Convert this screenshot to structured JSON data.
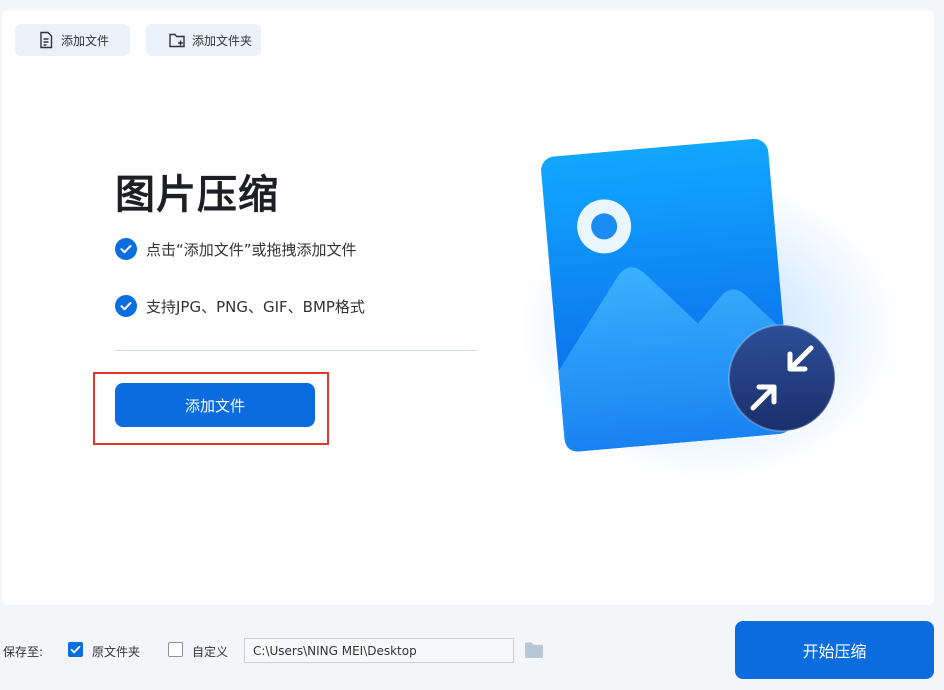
{
  "toolbar": {
    "add_file_label": "添加文件",
    "add_folder_label": "添加文件夹"
  },
  "main": {
    "title": "图片压缩",
    "features": [
      "点击“添加文件”或拖拽添加文件",
      "支持JPG、PNG、GIF、BMP格式"
    ],
    "add_file_button": "添加文件"
  },
  "bottom": {
    "save_to_label": "保存至:",
    "option_original": "原文件夹",
    "option_original_checked": true,
    "option_custom": "自定义",
    "option_custom_checked": false,
    "path_value": "C:\\Users\\NING MEI\\Desktop",
    "start_button": "开始压缩"
  },
  "colors": {
    "accent": "#0a6cdf",
    "highlight": "#e0382a"
  },
  "icons": {
    "add_file": "file-plus-icon",
    "add_folder": "folder-plus-icon",
    "check": "check-circle-icon",
    "browse": "folder-icon",
    "illustration": "image-compress-illustration"
  }
}
